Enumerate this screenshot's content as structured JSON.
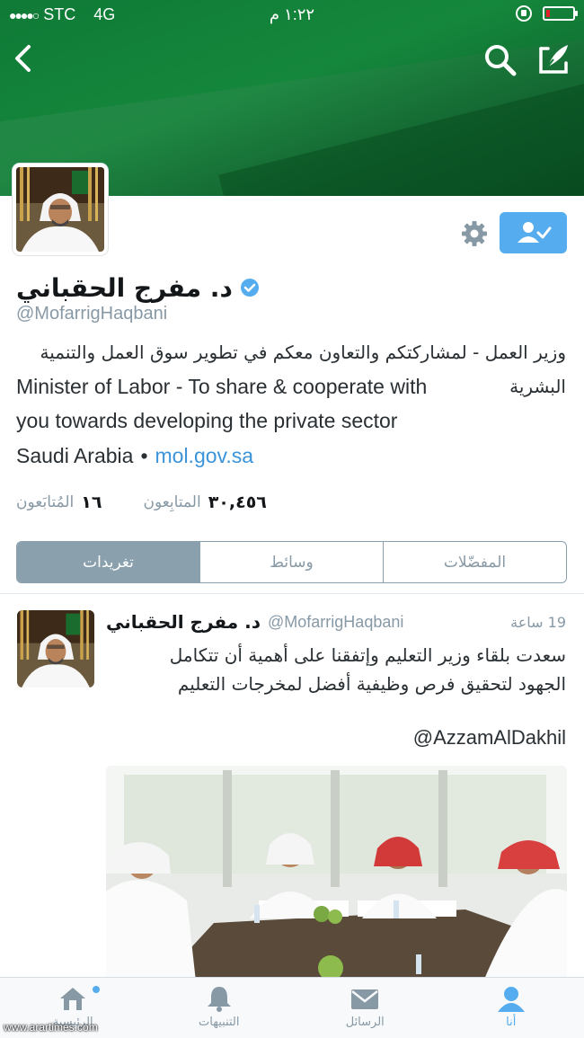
{
  "status_bar": {
    "carrier": "STC",
    "network": "4G",
    "time": "١:٢٢ م"
  },
  "profile": {
    "display_name": "د. مفرج الحقباني",
    "handle": "@MofarrigHaqbani",
    "bio_line_1": "وزير العمل - لمشاركتكم والتعاون معكم في تطوير سوق العمل والتنمية",
    "bio_line_2_en": "Minister of Labor - To share & cooperate with",
    "bio_line_2_ar": "البشرية",
    "bio_line_3": "you towards developing the private sector",
    "location": "Saudi Arabia",
    "separator": "•",
    "website": "mol.gov.sa",
    "followers_count": "٣٠,٤٥٦",
    "followers_label": "المتابِعون",
    "following_count": "١٦",
    "following_label": "المُتابَعون"
  },
  "tabs": [
    "تغريدات",
    "وسائط",
    "المفضّلات"
  ],
  "tweet": {
    "name": "د. مفرج الحقباني",
    "handle": "@MofarrigHaqbani",
    "time": "19 ساعة",
    "text_line_1": "سعدت بلقاء وزير التعليم وإتفقنا على أهمية أن تتكامل",
    "text_line_2": "الجهود لتحقيق فرص وظيفية أفضل لمخرجات التعليم",
    "mention": "@AzzamAlDakhil"
  },
  "tab_bar": {
    "home_label": "الرئيسية",
    "notifications_label": "التنبيهات",
    "messages_label": "الرسائل",
    "me_label": "أنا"
  },
  "watermark": "www.arartimes.com",
  "colors": {
    "header_green": "#15873c",
    "twitter_blue": "#55acee",
    "link_blue": "#3b94d9",
    "muted_gray": "#8899a6"
  }
}
